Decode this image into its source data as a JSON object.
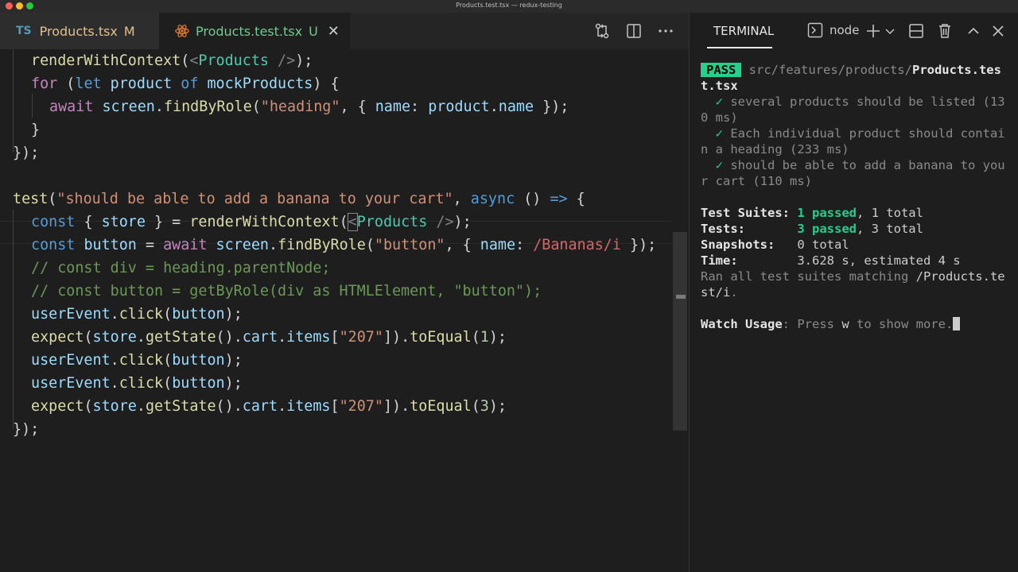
{
  "window": {
    "title": "Products.test.tsx — redux-testing"
  },
  "tabs": [
    {
      "icon": "TS",
      "name": "Products.tsx",
      "status": "M"
    },
    {
      "name": "Products.test.tsx",
      "status": "U",
      "close": "✕"
    }
  ],
  "code": {
    "l1": {
      "a": "renderWithContext",
      "b": "(",
      "c": "<",
      "d": "Products",
      "e": " />",
      "f": ");"
    },
    "l2": {
      "a": "for",
      "b": " (",
      "c": "let",
      "d": " product ",
      "e": "of",
      "f": " mockProducts",
      "g": ") {"
    },
    "l3": {
      "a": "await",
      "b": " screen",
      "c": ".",
      "d": "findByRole",
      "e": "(",
      "f": "\"heading\"",
      "g": ", { ",
      "h": "name",
      "i": ": ",
      "j": "product",
      "k": ".",
      "l": "name",
      "m": " });"
    },
    "l4": {
      "a": "}"
    },
    "l5": {
      "a": "});"
    },
    "l6": {
      "a": "test",
      "b": "(",
      "c": "\"should be able to add a banana to your cart\"",
      "d": ", ",
      "e": "async",
      "f": " () ",
      "g": "=>",
      "h": " {"
    },
    "l7": {
      "a": "const",
      "b": " { ",
      "c": "store",
      "d": " } = ",
      "e": "renderWithContext",
      "f": "(",
      "g": "<",
      "h": "Products",
      "i": " />",
      "j": ");"
    },
    "l8": {
      "a": "const",
      "b": " button",
      "c": " = ",
      "d": "await",
      "e": " screen",
      "f": ".",
      "g": "findByRole",
      "h": "(",
      "i": "\"button\"",
      "j": ", { ",
      "k": "name",
      "l": ": ",
      "m": "/Bananas/i",
      "n": " });"
    },
    "l9": {
      "a": "// const div = heading.parentNode;"
    },
    "l10": {
      "a": "// const button = getByRole(div as HTMLElement, \"button\");"
    },
    "l11": {
      "a": "userEvent",
      "b": ".",
      "c": "click",
      "d": "(",
      "e": "button",
      "f": ");"
    },
    "l12": {
      "a": "expect",
      "b": "(",
      "c": "store",
      "d": ".",
      "e": "getState",
      "f": "().",
      "g": "cart",
      "h": ".",
      "i": "items",
      "j": "[",
      "k": "\"207\"",
      "l": "]).",
      "m": "toEqual",
      "n": "(",
      "o": "1",
      "p": ");"
    },
    "l13": {
      "a": "userEvent",
      "b": ".",
      "c": "click",
      "d": "(",
      "e": "button",
      "f": ");"
    },
    "l14": {
      "a": "userEvent",
      "b": ".",
      "c": "click",
      "d": "(",
      "e": "button",
      "f": ");"
    },
    "l15": {
      "a": "expect",
      "b": "(",
      "c": "store",
      "d": ".",
      "e": "getState",
      "f": "().",
      "g": "cart",
      "h": ".",
      "i": "items",
      "j": "[",
      "k": "\"207\"",
      "l": "]).",
      "m": "toEqual",
      "n": "(",
      "o": "3",
      "p": ");"
    },
    "l16": {
      "a": "});"
    }
  },
  "panel": {
    "title": "TERMINAL",
    "shell": "node"
  },
  "terminal": {
    "pass": "PASS",
    "path_dim": "src/features/products/",
    "path_bold": "Products.tes",
    "path_cont": "t.tsx",
    "tests": [
      {
        "mark": "✓",
        "l1": " several products should be listed (13",
        "l2": "0 ms)"
      },
      {
        "mark": "✓",
        "l1": " Each individual product should contai",
        "l2": "n a heading (233 ms)"
      },
      {
        "mark": "✓",
        "l1": " should be able to add a banana to you",
        "l2": "r cart (110 ms)"
      }
    ],
    "suites_label": "Test Suites: ",
    "suites_passed": "1 passed",
    "suites_rest": ", 1 total",
    "tests_label": "Tests:       ",
    "tests_passed": "3 passed",
    "tests_rest": ", 3 total",
    "snap_label": "Snapshots:   ",
    "snap_rest": "0 total",
    "time_label": "Time:        ",
    "time_rest": "3.628 s, estimated 4 s",
    "ran1_dim": "Ran all test suites matching ",
    "ran1_val": "/Products.te",
    "ran2_val": "st/i",
    "ran2_dim": ".",
    "watch_label": "Watch Usage",
    "watch_dim1": ": Press ",
    "watch_key": "w",
    "watch_dim2": " to show more."
  }
}
